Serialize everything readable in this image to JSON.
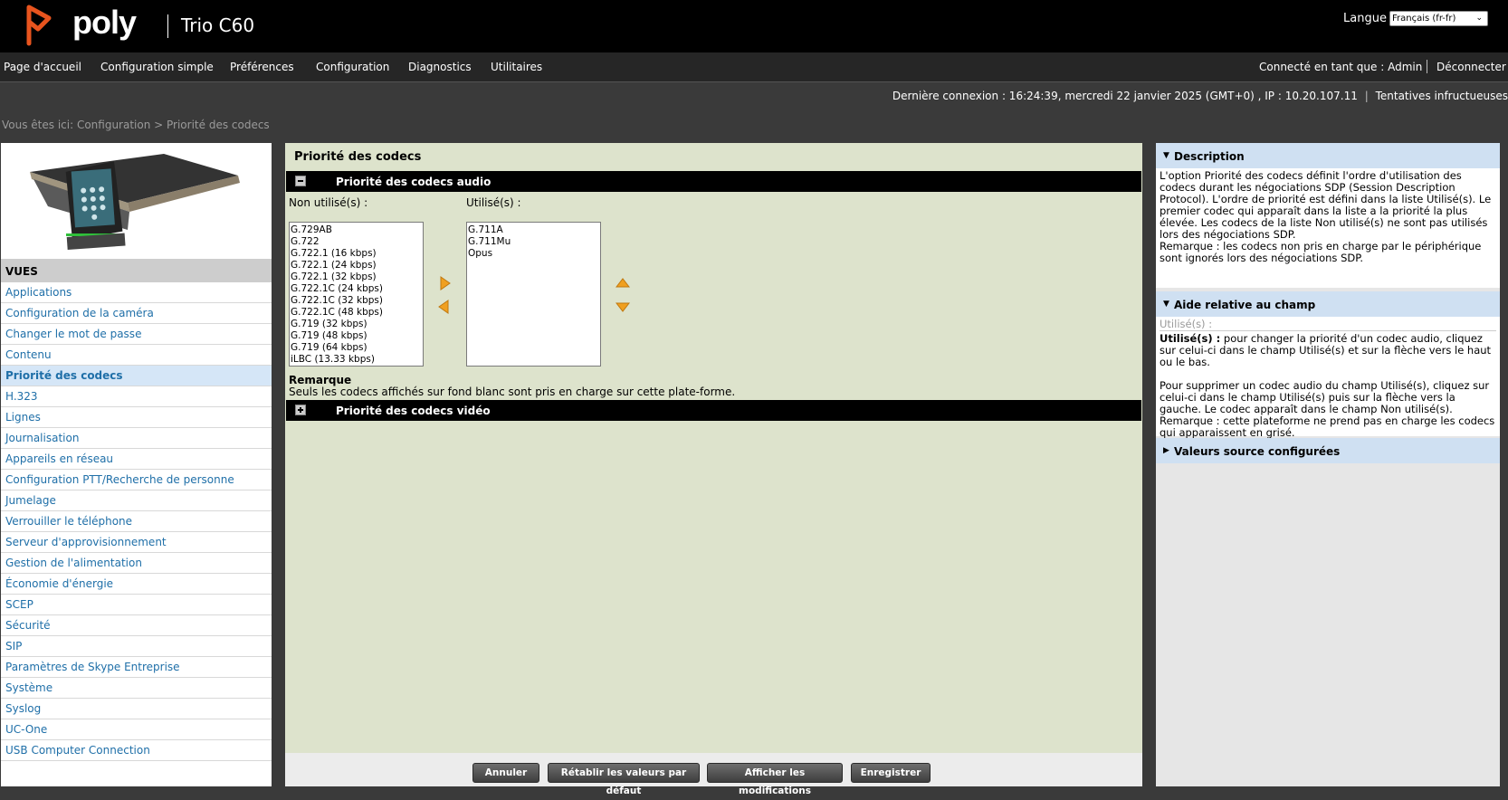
{
  "header": {
    "brand": "poly",
    "product": "Trio C60",
    "language_label": "Langue",
    "language_value": "Français (fr-fr)"
  },
  "nav": {
    "items": [
      "Page d'accueil",
      "Configuration simple",
      "Préférences",
      "Configuration",
      "Diagnostics",
      "Utilitaires"
    ],
    "logged_in": "Connecté en tant que : Admin",
    "logout": "Déconnecter"
  },
  "info": {
    "last_login": "Dernière connexion : 16:24:39, mercredi 22 janvier 2025 (GMT+0) , IP : 10.20.107.11",
    "failed_attempts": "Tentatives infructueuses"
  },
  "breadcrumb": "Vous êtes ici: Configuration > Priorité des codecs",
  "sidebar": {
    "heading": "VUES",
    "items": [
      {
        "label": "Applications",
        "active": false
      },
      {
        "label": "Configuration de la caméra",
        "active": false
      },
      {
        "label": "Changer le mot de passe",
        "active": false
      },
      {
        "label": "Contenu",
        "active": false
      },
      {
        "label": "Priorité des codecs",
        "active": true
      },
      {
        "label": "H.323",
        "active": false
      },
      {
        "label": "Lignes",
        "active": false
      },
      {
        "label": "Journalisation",
        "active": false
      },
      {
        "label": "Appareils en réseau",
        "active": false
      },
      {
        "label": "Configuration PTT/Recherche de personne",
        "active": false
      },
      {
        "label": "Jumelage",
        "active": false
      },
      {
        "label": "Verrouiller le téléphone",
        "active": false
      },
      {
        "label": "Serveur d'approvisionnement",
        "active": false
      },
      {
        "label": "Gestion de l'alimentation",
        "active": false
      },
      {
        "label": "Économie d'énergie",
        "active": false
      },
      {
        "label": "SCEP",
        "active": false
      },
      {
        "label": "Sécurité",
        "active": false
      },
      {
        "label": "SIP",
        "active": false
      },
      {
        "label": "Paramètres de Skype Entreprise",
        "active": false
      },
      {
        "label": "Système",
        "active": false
      },
      {
        "label": "Syslog",
        "active": false
      },
      {
        "label": "UC-One",
        "active": false
      },
      {
        "label": "USB Computer Connection",
        "active": false
      }
    ]
  },
  "main": {
    "title": "Priorité des codecs",
    "audio_section": "Priorité des codecs audio",
    "unused_label": "Non utilisé(s) :",
    "used_label": "Utilisé(s) :",
    "unused_codecs": [
      "G.729AB",
      "G.722",
      "G.722.1 (16 kbps)",
      "G.722.1 (24 kbps)",
      "G.722.1 (32 kbps)",
      "G.722.1C (24 kbps)",
      "G.722.1C (32 kbps)",
      "G.722.1C (48 kbps)",
      "G.719 (32 kbps)",
      "G.719 (48 kbps)",
      "G.719 (64 kbps)",
      "iLBC (13.33 kbps)"
    ],
    "used_codecs": [
      "G.711A",
      "G.711Mu",
      "Opus"
    ],
    "remark_title": "Remarque",
    "remark_text": "Seuls les codecs affichés sur fond blanc sont pris en charge sur cette plate-forme.",
    "video_section": "Priorité des codecs vidéo",
    "buttons": {
      "cancel": "Annuler",
      "reset": "Rétablir les valeurs par défaut",
      "show_changes": "Afficher les modifications",
      "save": "Enregistrer"
    }
  },
  "right": {
    "description_title": "Description",
    "description_text": "L'option Priorité des codecs définit l'ordre d'utilisation des codecs durant les négociations SDP (Session Description Protocol). L'ordre de priorité est défini dans la liste Utilisé(s). Le premier codec qui apparaît dans la liste a la priorité la plus élevée. Les codecs de la liste Non utilisé(s) ne sont pas utilisés lors des négociations SDP.",
    "description_note": "Remarque : les codecs non pris en charge par le périphérique sont ignorés lors des négociations SDP.",
    "help_title": "Aide relative au champ",
    "help_field": "Utilisé(s) :",
    "help_bold": "Utilisé(s) :",
    "help_text1": " pour changer la priorité d'un codec audio, cliquez sur celui-ci dans le champ Utilisé(s) et sur la flèche vers le haut ou le bas.",
    "help_text2": "Pour supprimer un codec audio du champ Utilisé(s), cliquez sur celui-ci dans le champ Utilisé(s) puis sur la flèche vers la gauche. Le codec apparaît dans le champ Non utilisé(s).",
    "help_note": "Remarque : cette plateforme ne prend pas en charge les codecs qui apparaissent en grisé.",
    "source_title": "Valeurs source configurées"
  },
  "colors": {
    "accent_orange": "#f0a020",
    "logo_orange": "#e8541e",
    "link_blue": "#1f6fa8",
    "main_bg": "#dde3cc",
    "header_blue": "#cfe0f2"
  }
}
